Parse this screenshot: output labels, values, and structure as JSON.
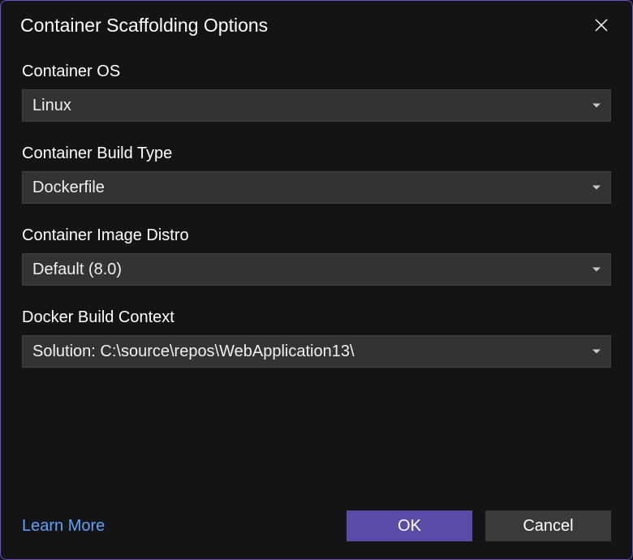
{
  "dialog": {
    "title": "Container Scaffolding Options"
  },
  "fields": {
    "os": {
      "label": "Container OS",
      "value": "Linux"
    },
    "buildType": {
      "label": "Container Build Type",
      "value": "Dockerfile"
    },
    "imageDistro": {
      "label": "Container Image Distro",
      "value": "Default (8.0)"
    },
    "buildContext": {
      "label": "Docker Build Context",
      "value": "Solution: C:\\source\\repos\\WebApplication13\\"
    }
  },
  "footer": {
    "learnMore": "Learn More",
    "ok": "OK",
    "cancel": "Cancel"
  }
}
